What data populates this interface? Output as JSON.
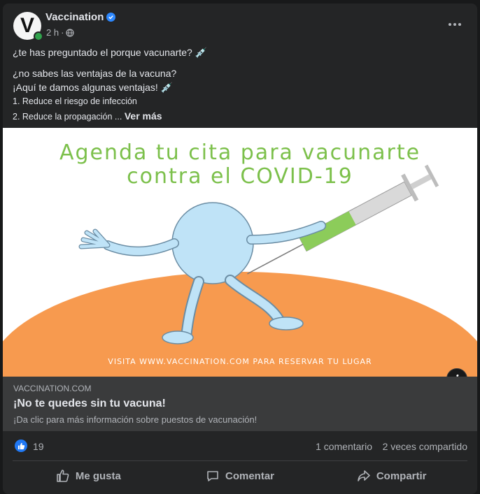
{
  "post": {
    "page_name": "Vaccination",
    "avatar_letter": "V",
    "time": "2 h",
    "separator": "·",
    "line1": "¿te has preguntado el porque vacunarte? 💉",
    "line2": "¿no sabes las ventajas de la vacuna?",
    "line3": "¡Aquí te damos algunas ventajas! 💉",
    "line4": "1. Reduce el riesgo de infección",
    "line5": "2. Reduce la propagación ...",
    "see_more": "Ver más"
  },
  "image": {
    "title_line1": "Agenda tu cita para vacunarte",
    "title_line2": "contra el COVID-19",
    "footer": "VISITA WWW.VACCINATION.COM PARA RESERVAR TU LUGAR",
    "info_icon": "i"
  },
  "link": {
    "domain": "VACCINATION.COM",
    "title": "¡No te quedes sin tu vacuna!",
    "description": "¡Da clic para más información sobre puestos de vacunación!"
  },
  "stats": {
    "likes": "19",
    "comments": "1 comentario",
    "shares": "2 veces compartido"
  },
  "actions": {
    "like": "Me gusta",
    "comment": "Comentar",
    "share": "Compartir"
  },
  "colors": {
    "accent": "#2d88ff",
    "online": "#31a24c",
    "title_green": "#7cc04b",
    "ground_orange": "#f79a4f",
    "mascot_blue": "#bfe3f7"
  }
}
